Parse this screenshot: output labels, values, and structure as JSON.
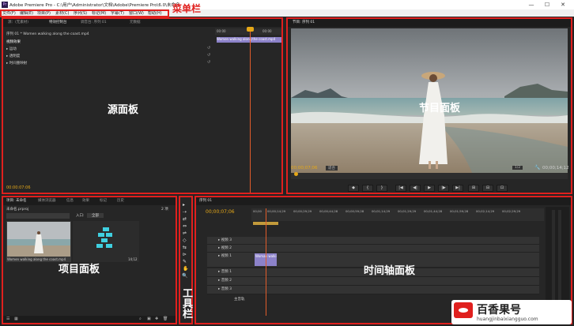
{
  "window": {
    "title": "Adobe Premiere Pro - C:\\用户\\Administrator\\文档\\Adobe\\Premiere Pro\\6.0\\未命名",
    "app_icon": "Pr",
    "min": "—",
    "max": "☐",
    "close": "✕"
  },
  "menu": [
    "文件(F)",
    "编辑(E)",
    "项目(P)",
    "素材(C)",
    "序列(S)",
    "标记(M)",
    "字幕(T)",
    "窗口(W)",
    "帮助(H)"
  ],
  "annotations": {
    "menubar": "菜单栏",
    "source": "源面板",
    "program": "节目面板",
    "project": "项目面板",
    "tools": "工具栏",
    "timeline": "时间轴面板"
  },
  "source_panel": {
    "tabs": [
      "源：(无素材)",
      "特效控制台",
      "调音台: 序列 01",
      "元数据"
    ],
    "clip_header": "序列 01 * Women walking along the coast.mp4",
    "section": "视频效果",
    "effects": [
      "运动",
      "透明度",
      "时间重映射"
    ],
    "clip_name": "Women walking along the coast.mp4",
    "ruler_start": "00:00",
    "ruler_end": "00:00",
    "timecode": "00:00:07:06"
  },
  "program_panel": {
    "tab": "节目: 序列 01",
    "timecode_left": "00;00;07;06",
    "fit": "适合",
    "scale": "1/2",
    "timecode_right": "00;00;14;12",
    "controls": [
      "◆",
      "{",
      "}",
      "|◀",
      "◀|",
      "▶",
      "|▶",
      "▶|",
      "⊞",
      "⊟",
      "⊡"
    ]
  },
  "project_panel": {
    "tabs": [
      "项目: 未命名",
      "媒体浏览器",
      "信息",
      "效果",
      "标记",
      "历史"
    ],
    "file": "未命名.prproj",
    "item_count": "2 项",
    "in_label": "入口:",
    "in_value": "全部",
    "items": [
      {
        "name": "Women walking along the coast.mp4",
        "duration": ""
      },
      {
        "name": "序列 01",
        "duration": "14;12"
      }
    ]
  },
  "timeline_panel": {
    "tab": "序列 01",
    "timecode": "00;00;07;06",
    "ruler": [
      "00;00",
      "00;00;14;29",
      "00;00;29;29",
      "00;00;44;28",
      "00;00;59;28",
      "00;01;14;29",
      "00;01;29;29",
      "00;01;44;28",
      "00;01;59;28",
      "00;02;14;29",
      "00;02;29;29"
    ],
    "video_tracks": [
      "视频 3",
      "视频 2",
      "视频 1"
    ],
    "audio_tracks": [
      "音频 1",
      "音频 2",
      "音频 3"
    ],
    "master": "主音轨",
    "clip_label": "Woman walki"
  },
  "tools": [
    "▸",
    "⇢",
    "⇄",
    "⇔",
    "⇌",
    "◇",
    "⇆",
    "⊳",
    "✎",
    "✋",
    "🔍"
  ],
  "watermark": {
    "brand": "百香果号",
    "url": "huangjinbaixiangguo.com"
  },
  "colors": {
    "accent": "#e0201e",
    "timecode": "#e6a817",
    "clip": "#8c82c9"
  }
}
